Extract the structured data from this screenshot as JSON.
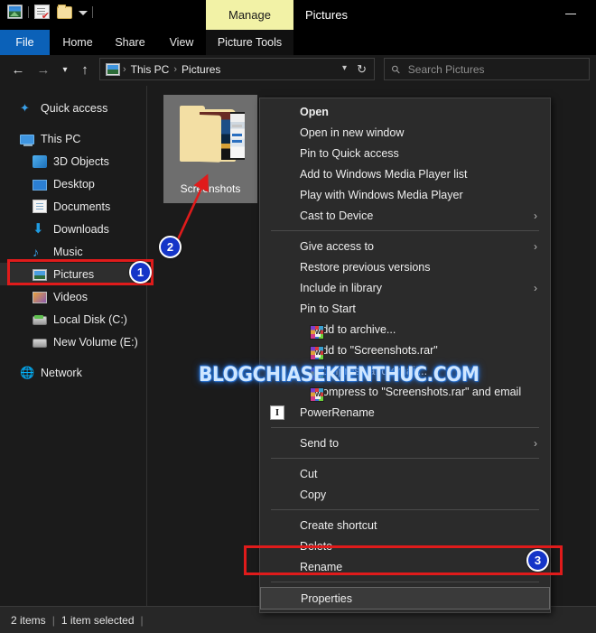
{
  "window": {
    "title": "Pictures",
    "minimize_label": "Minimize",
    "quick_access": [
      {
        "name": "picture-properties-icon",
        "label": "Picture"
      },
      {
        "name": "properties-icon",
        "label": "Properties"
      },
      {
        "name": "new-folder-icon",
        "label": "New folder"
      },
      {
        "name": "customize-caret-icon",
        "label": "Customize Quick Access Toolbar"
      }
    ],
    "manage_tab": "Manage"
  },
  "ribbon": {
    "tabs": [
      {
        "label": "File",
        "name": "tab-file"
      },
      {
        "label": "Home",
        "name": "tab-home"
      },
      {
        "label": "Share",
        "name": "tab-share"
      },
      {
        "label": "View",
        "name": "tab-view"
      },
      {
        "label": "Picture Tools",
        "name": "tab-picture-tools"
      }
    ]
  },
  "nav": {
    "back": "←",
    "forward": "→",
    "recent": "▾",
    "up": "↑",
    "refresh": "↻",
    "dropdown": "▾",
    "breadcrumb": [
      "This PC",
      "Pictures"
    ],
    "separator": "›"
  },
  "search": {
    "placeholder": "Search Pictures",
    "icon": "search-icon"
  },
  "sidebar": {
    "items": [
      {
        "label": "Quick access",
        "icon": "star-icon",
        "level": 0,
        "gap_after": true,
        "selected": false
      },
      {
        "label": "This PC",
        "icon": "computer-icon",
        "level": 0,
        "gap_after": false,
        "selected": false
      },
      {
        "label": "3D Objects",
        "icon": "3d-objects-icon",
        "level": 1,
        "gap_after": false,
        "selected": false
      },
      {
        "label": "Desktop",
        "icon": "desktop-icon",
        "level": 1,
        "gap_after": false,
        "selected": false
      },
      {
        "label": "Documents",
        "icon": "documents-icon",
        "level": 1,
        "gap_after": false,
        "selected": false
      },
      {
        "label": "Downloads",
        "icon": "downloads-icon",
        "level": 1,
        "gap_after": false,
        "selected": false
      },
      {
        "label": "Music",
        "icon": "music-icon",
        "level": 1,
        "gap_after": false,
        "selected": false
      },
      {
        "label": "Pictures",
        "icon": "pictures-icon",
        "level": 1,
        "gap_after": false,
        "selected": true
      },
      {
        "label": "Videos",
        "icon": "videos-icon",
        "level": 1,
        "gap_after": false,
        "selected": false
      },
      {
        "label": "Local Disk (C:)",
        "icon": "disk-icon",
        "level": 1,
        "gap_after": false,
        "selected": false
      },
      {
        "label": "New Volume (E:)",
        "icon": "disk-icon",
        "level": 1,
        "gap_after": true,
        "selected": false
      },
      {
        "label": "Network",
        "icon": "network-icon",
        "level": 0,
        "gap_after": false,
        "selected": false
      }
    ]
  },
  "files": {
    "items": [
      {
        "label": "Screenshots",
        "icon": "folder-with-pictures-icon",
        "selected": true
      }
    ]
  },
  "context_menu": {
    "groups": [
      {
        "items": [
          {
            "label": "Open",
            "bold": true,
            "icon": null,
            "submenu": false
          },
          {
            "label": "Open in new window",
            "bold": false,
            "icon": null,
            "submenu": false
          },
          {
            "label": "Pin to Quick access",
            "bold": false,
            "icon": null,
            "submenu": false
          },
          {
            "label": "Add to Windows Media Player list",
            "bold": false,
            "icon": null,
            "submenu": false
          },
          {
            "label": "Play with Windows Media Player",
            "bold": false,
            "icon": null,
            "submenu": false
          },
          {
            "label": "Cast to Device",
            "bold": false,
            "icon": null,
            "submenu": true
          }
        ]
      },
      {
        "items": [
          {
            "label": "Give access to",
            "bold": false,
            "icon": null,
            "submenu": true
          },
          {
            "label": "Restore previous versions",
            "bold": false,
            "icon": null,
            "submenu": false
          },
          {
            "label": "Include in library",
            "bold": false,
            "icon": null,
            "submenu": true
          },
          {
            "label": "Pin to Start",
            "bold": false,
            "icon": null,
            "submenu": false
          },
          {
            "label": "Add to archive...",
            "bold": false,
            "icon": "winrar-icon",
            "submenu": false
          },
          {
            "label": "Add to \"Screenshots.rar\"",
            "bold": false,
            "icon": "winrar-icon",
            "submenu": false
          },
          {
            "label": "Compress and email...",
            "bold": false,
            "icon": "winrar-icon",
            "submenu": false
          },
          {
            "label": "Compress to \"Screenshots.rar\" and email",
            "bold": false,
            "icon": "winrar-icon",
            "submenu": false
          },
          {
            "label": "PowerRename",
            "bold": false,
            "icon": "powerrename-icon",
            "submenu": false
          }
        ]
      },
      {
        "items": [
          {
            "label": "Send to",
            "bold": false,
            "icon": null,
            "submenu": true
          }
        ]
      },
      {
        "items": [
          {
            "label": "Cut",
            "bold": false,
            "icon": null,
            "submenu": false
          },
          {
            "label": "Copy",
            "bold": false,
            "icon": null,
            "submenu": false
          }
        ]
      },
      {
        "items": [
          {
            "label": "Create shortcut",
            "bold": false,
            "icon": null,
            "submenu": false
          },
          {
            "label": "Delete",
            "bold": false,
            "icon": null,
            "submenu": false
          },
          {
            "label": "Rename",
            "bold": false,
            "icon": null,
            "submenu": false
          }
        ]
      },
      {
        "items": [
          {
            "label": "Properties",
            "bold": false,
            "icon": null,
            "submenu": false,
            "hovered": true
          }
        ]
      }
    ],
    "submenu_arrow": "›"
  },
  "statusbar": {
    "item_count": "2 items",
    "selection": "1 item selected",
    "divider": "|"
  },
  "annotations": {
    "badges": [
      {
        "number": "1",
        "target": "sidebar-item-pictures"
      },
      {
        "number": "2",
        "target": "file-tile-screenshots"
      },
      {
        "number": "3",
        "target": "menu-item-properties"
      }
    ],
    "highlight_color": "#e01b1b",
    "badge_color": "#1535c8"
  },
  "watermark": {
    "text": "BLOGCHIASEKIENTHUC.COM",
    "color": "#cfe6ff",
    "glow": "#2f7fe0"
  }
}
